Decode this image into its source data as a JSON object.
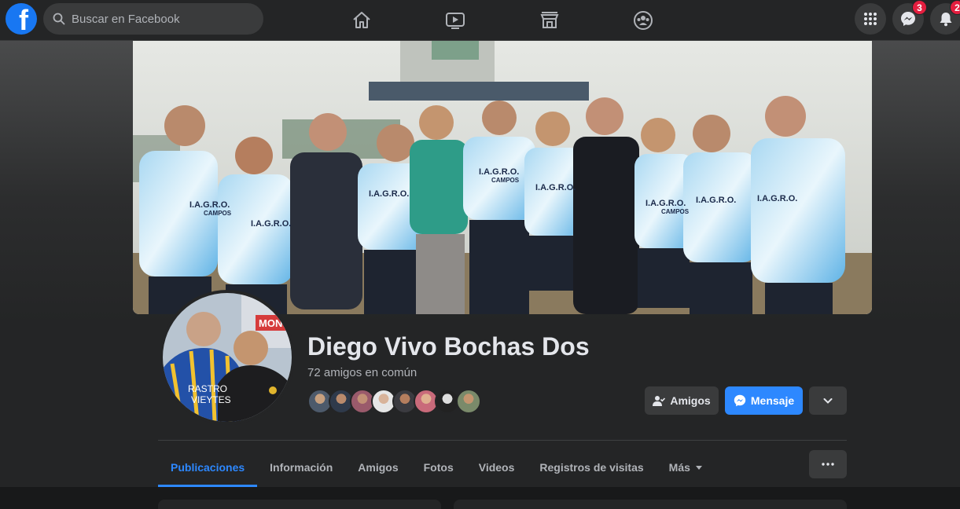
{
  "topbar": {
    "logo_letter": "f",
    "search_placeholder": "Buscar en Facebook",
    "nav_icons": [
      "home-icon",
      "watch-icon",
      "marketplace-icon",
      "groups-icon"
    ],
    "menu_icon": "grid-menu-icon",
    "messenger_badge": "3",
    "notifications_badge": "2"
  },
  "profile": {
    "name": "Diego Vivo Bochas Dos",
    "mutual_friends": "72 amigos en común",
    "avatar_text": [
      "RASTRO",
      "VIEYTES"
    ],
    "avatar_sign": "MON"
  },
  "actions": {
    "friends_label": "Amigos",
    "message_label": "Mensaje"
  },
  "cover": {
    "jersey_text": "I.A.G.R.O.",
    "jersey_subtext": "CAMPOS"
  },
  "tabs": [
    {
      "label": "Publicaciones",
      "active": true
    },
    {
      "label": "Información"
    },
    {
      "label": "Amigos"
    },
    {
      "label": "Fotos"
    },
    {
      "label": "Videos"
    },
    {
      "label": "Registros de visitas"
    },
    {
      "label": "Más"
    }
  ],
  "colors": {
    "accent": "#2d88ff",
    "brand": "#1877f2",
    "badge": "#e41e3f",
    "background": "#18191a",
    "surface": "#242526"
  }
}
